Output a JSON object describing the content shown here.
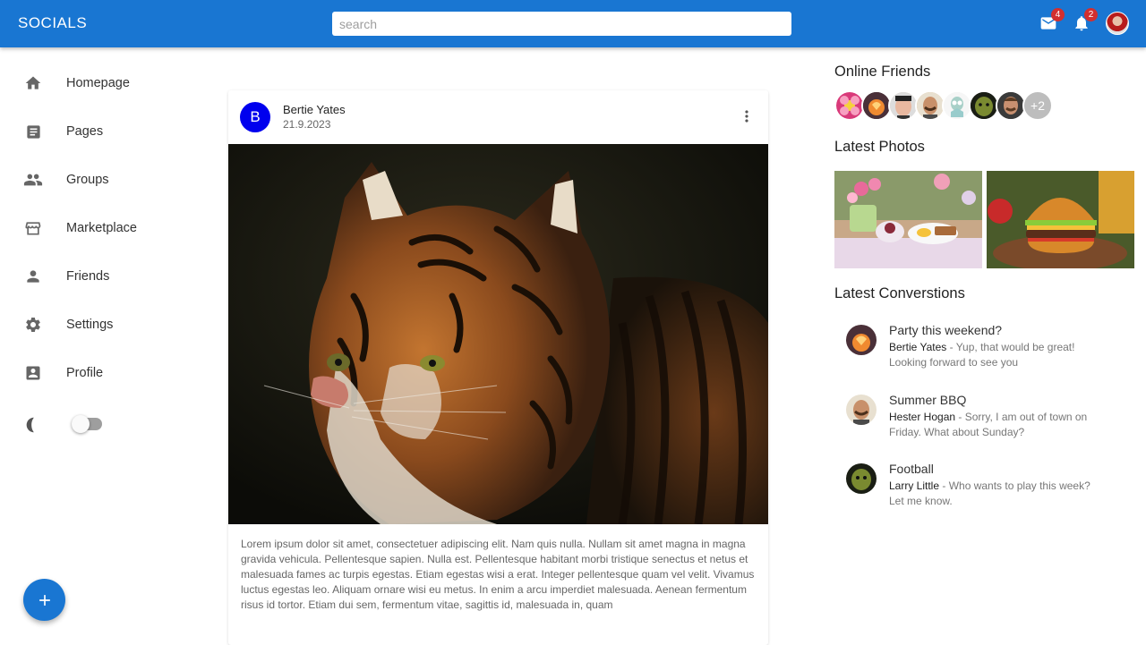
{
  "app": {
    "title": "SOCIALS"
  },
  "search": {
    "placeholder": "search"
  },
  "header": {
    "mail_icon": "mail-icon",
    "mail_badge": "4",
    "notifications_icon": "bell-icon",
    "notifications_badge": "2"
  },
  "sidebar": {
    "items": [
      {
        "label": "Homepage",
        "icon": "home-icon"
      },
      {
        "label": "Pages",
        "icon": "article-icon"
      },
      {
        "label": "Groups",
        "icon": "group-icon"
      },
      {
        "label": "Marketplace",
        "icon": "storefront-icon"
      },
      {
        "label": "Friends",
        "icon": "person-icon"
      },
      {
        "label": "Settings",
        "icon": "gear-icon"
      },
      {
        "label": "Profile",
        "icon": "account-box-icon"
      }
    ],
    "dark_mode": {
      "icon": "moon-icon",
      "enabled": false
    }
  },
  "post": {
    "avatar_letter": "B",
    "avatar_color": "#0000ee",
    "author": "Bertie Yates",
    "date": "21.9.2023",
    "image": "tiger-photo",
    "text": "Lorem ipsum dolor sit amet, consectetuer adipiscing elit. Nam quis nulla. Nullam sit amet magna in magna gravida vehicula. Pellentesque sapien. Nulla est. Pellentesque habitant morbi tristique senectus et netus et malesuada fames ac turpis egestas. Etiam egestas wisi a erat. Integer pellentesque quam vel velit. Vivamus luctus egestas leo. Aliquam ornare wisi eu metus. In enim a arcu imperdiet malesuada. Aenean fermentum risus id tortor. Etiam dui sem, fermentum vitae, sagittis id, malesuada in, quam"
  },
  "right": {
    "online_title": "Online Friends",
    "online_more": "+2",
    "photos_title": "Latest Photos",
    "conversations_title": "Latest Converstions",
    "conversations": [
      {
        "title": "Party this weekend?",
        "sender": "Bertie Yates",
        "message": " - Yup, that would be great! Looking forward to see you"
      },
      {
        "title": "Summer BBQ",
        "sender": "Hester Hogan",
        "message": " - Sorry, I am out of town on Friday. What about Sunday?"
      },
      {
        "title": "Football",
        "sender": "Larry Little",
        "message": " - Who wants to play this week? Let me know."
      }
    ]
  },
  "colors": {
    "primary": "#1976d2",
    "badge": "#d32f2f"
  }
}
